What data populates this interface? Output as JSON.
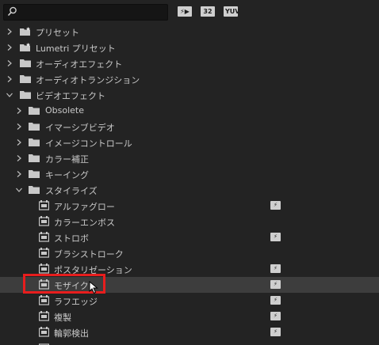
{
  "search": {
    "value": "",
    "placeholder": ""
  },
  "filters": [
    {
      "label": "⚡▶",
      "icon": "accelerated-effects-filter"
    },
    {
      "label": "32",
      "icon": "32bit-effects-filter"
    },
    {
      "label": "YUV",
      "icon": "yuv-effects-filter"
    }
  ],
  "tree": {
    "presets": "プリセット",
    "lumetri": "Lumetri プリセット",
    "audio_effects": "オーディオエフェクト",
    "audio_transitions": "オーディオトランジション",
    "video_effects": "ビデオエフェクト",
    "obsolete": "Obsolete",
    "immersive": "イマーシブビデオ",
    "image_control": "イメージコントロール",
    "color_correction": "カラー補正",
    "keying": "キーイング",
    "stylize": "スタイライズ",
    "items": [
      {
        "label": "アルファグロー",
        "accelerated": true
      },
      {
        "label": "カラーエンボス",
        "accelerated": false
      },
      {
        "label": "ストロボ",
        "accelerated": true
      },
      {
        "label": "ブラシストローク",
        "accelerated": false
      },
      {
        "label": "ポスタリゼーション",
        "accelerated": true
      },
      {
        "label": "モザイク",
        "accelerated": true,
        "selected": true
      },
      {
        "label": "ラフエッジ",
        "accelerated": true
      },
      {
        "label": "複製",
        "accelerated": true
      },
      {
        "label": "輪郭検出",
        "accelerated": true
      }
    ]
  },
  "colors": {
    "highlight_box": "#e81d1d",
    "selected_row": "#3d3d3d",
    "background": "#232323"
  }
}
